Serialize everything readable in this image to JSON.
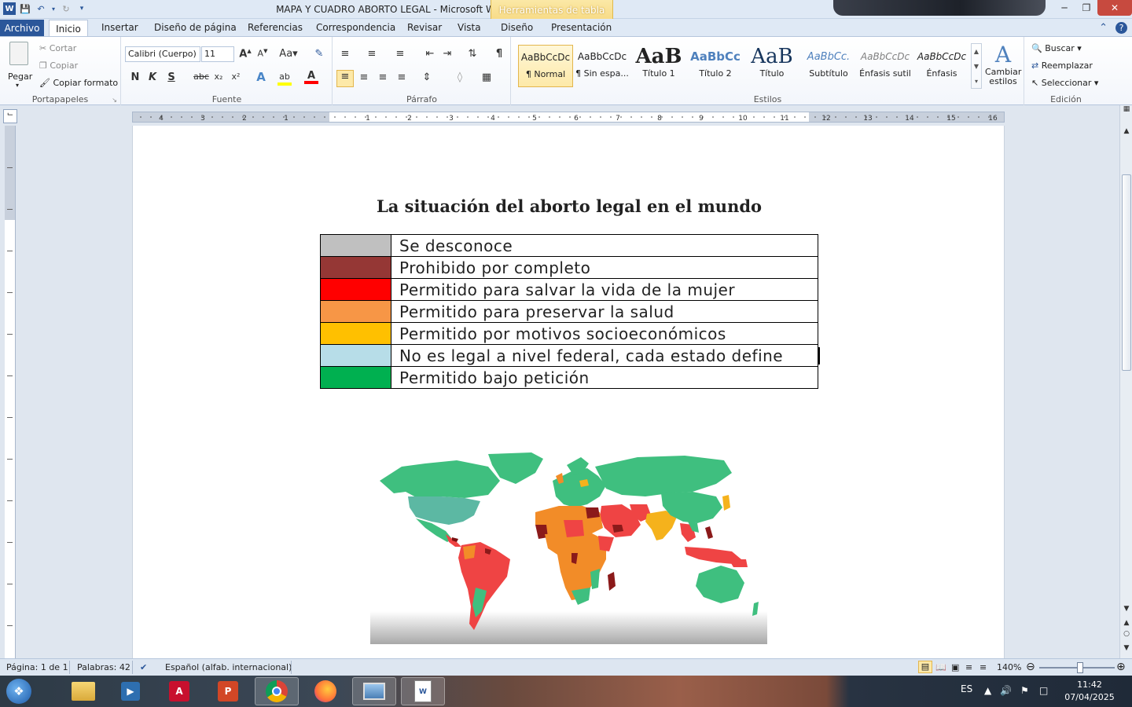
{
  "window": {
    "title": "MAPA Y CUADRO ABORTO LEGAL  -  Microsoft Word",
    "context_tab_header": "Herramientas de tabla"
  },
  "tabs": [
    {
      "label": "Archivo"
    },
    {
      "label": "Inicio"
    },
    {
      "label": "Insertar"
    },
    {
      "label": "Diseño de página"
    },
    {
      "label": "Referencias"
    },
    {
      "label": "Correspondencia"
    },
    {
      "label": "Revisar"
    },
    {
      "label": "Vista"
    },
    {
      "label": "Diseño"
    },
    {
      "label": "Presentación"
    }
  ],
  "ribbon": {
    "clipboard": {
      "paste": "Pegar",
      "cut": "Cortar",
      "copy": "Copiar",
      "format_painter": "Copiar formato",
      "group": "Portapapeles"
    },
    "font": {
      "font_name": "Calibri (Cuerpo)",
      "font_size": "11",
      "group": "Fuente"
    },
    "paragraph": {
      "group": "Párrafo"
    },
    "styles": {
      "items": [
        {
          "sample": "AaBbCcDc",
          "name": "¶ Normal"
        },
        {
          "sample": "AaBbCcDc",
          "name": "¶ Sin espa..."
        },
        {
          "sample": "AaB",
          "name": "Título 1"
        },
        {
          "sample": "AaBbCc",
          "name": "Título 2"
        },
        {
          "sample": "AaB",
          "name": "Título"
        },
        {
          "sample": "AaBbCc.",
          "name": "Subtítulo"
        },
        {
          "sample": "AaBbCcDc",
          "name": "Énfasis sutil"
        },
        {
          "sample": "AaBbCcDc",
          "name": "Énfasis"
        }
      ],
      "change_styles": "Cambiar estilos",
      "group": "Estilos"
    },
    "editing": {
      "find": "Buscar",
      "replace": "Reemplazar",
      "select": "Seleccionar",
      "group": "Edición"
    }
  },
  "ruler": {
    "numbers": [
      "4",
      "3",
      "2",
      "1",
      "1",
      "2",
      "3",
      "4",
      "5",
      "6",
      "7",
      "8",
      "9",
      "10",
      "11",
      "12",
      "13",
      "14",
      "15",
      "16"
    ]
  },
  "document": {
    "heading": "La situación del aborto legal en el mundo",
    "legend": [
      {
        "color": "#c0c0c0",
        "label": "Se desconoce"
      },
      {
        "color": "#953735",
        "label": "Prohibido por completo"
      },
      {
        "color": "#ff0000",
        "label": "Permitido para salvar la vida de la mujer"
      },
      {
        "color": "#f79646",
        "label": "Permitido para preservar la salud"
      },
      {
        "color": "#ffc000",
        "label": "Permitido por motivos socioeconómicos"
      },
      {
        "color": "#b7dde8",
        "label": "No es legal a nivel federal, cada estado define"
      },
      {
        "color": "#00b050",
        "label": "Permitido bajo petición"
      }
    ]
  },
  "status": {
    "page": "Página: 1 de 1",
    "words": "Palabras: 42",
    "language": "Español (alfab. internacional)",
    "zoom": "140%"
  },
  "taskbar": {
    "lang": "ES",
    "time": "11:42",
    "date": "07/04/2025"
  }
}
